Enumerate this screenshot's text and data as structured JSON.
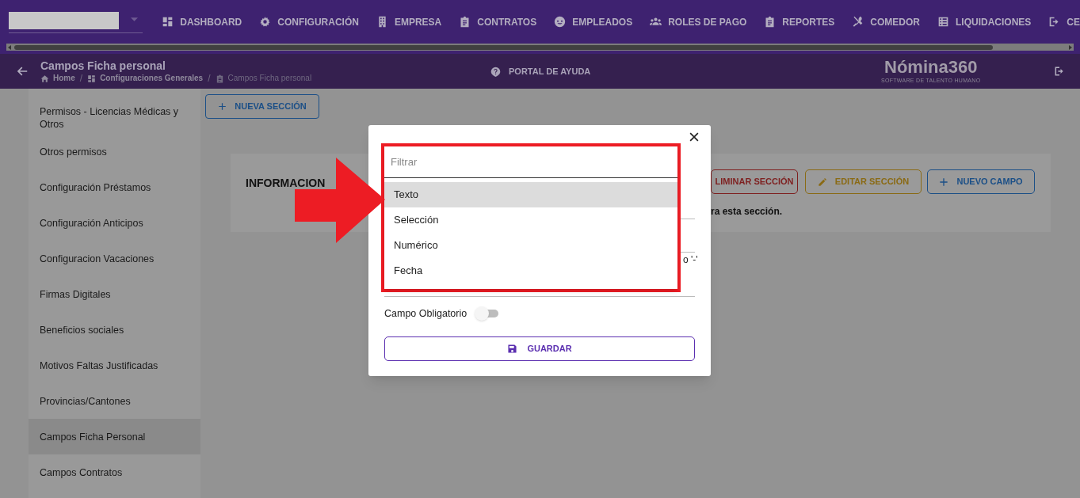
{
  "nav": {
    "items": [
      {
        "label": "DASHBOARD"
      },
      {
        "label": "CONFIGURACIÓN"
      },
      {
        "label": "EMPRESA"
      },
      {
        "label": "CONTRATOS"
      },
      {
        "label": "EMPLEADOS"
      },
      {
        "label": "ROLES DE PAGO"
      },
      {
        "label": "REPORTES"
      },
      {
        "label": "COMEDOR"
      },
      {
        "label": "LIQUIDACIONES"
      },
      {
        "label": "CE"
      }
    ]
  },
  "header": {
    "title": "Campos Ficha personal",
    "breadcrumb": [
      {
        "kind": "link",
        "label": "Home"
      },
      {
        "kind": "separator",
        "label": "/"
      },
      {
        "kind": "link",
        "label": "Configuraciones Generales"
      },
      {
        "kind": "separator",
        "label": "/"
      },
      {
        "kind": "current",
        "label": "Campos Ficha personal"
      }
    ],
    "help": "PORTAL DE AYUDA",
    "logo": "Nómina360",
    "logo_tagline": "SOFTWARE DE TALENTO HUMANO"
  },
  "sidebar": {
    "items": [
      {
        "label": "Permisos - Licencias Médicas y Otros",
        "selected": false
      },
      {
        "label": "Otros permisos",
        "selected": false
      },
      {
        "label": "Configuración Préstamos",
        "selected": false
      },
      {
        "label": "Configuración Anticipos",
        "selected": false
      },
      {
        "label": "Configuracion Vacaciones",
        "selected": false
      },
      {
        "label": "Firmas Digitales",
        "selected": false
      },
      {
        "label": "Beneficios sociales",
        "selected": false
      },
      {
        "label": "Motivos Faltas Justificadas",
        "selected": false
      },
      {
        "label": "Provincias/Cantones",
        "selected": false
      },
      {
        "label": "Campos Ficha Personal",
        "selected": true
      },
      {
        "label": "Campos Contratos",
        "selected": false
      }
    ]
  },
  "new_section_button": "NUEVA SECCIÓN",
  "section_card": {
    "title": "INFORMACION",
    "buttons": [
      {
        "label": "LIMINAR SECCIÓN",
        "kind": "delete"
      },
      {
        "label": "EDITAR SECCIÓN",
        "kind": "edit"
      },
      {
        "label": "NUEVO CAMPO",
        "kind": "add"
      }
    ],
    "message": "ra esta sección."
  },
  "dialog": {
    "behind_text": "o '-'",
    "filter_placeholder": "Filtrar",
    "options": [
      {
        "label": "Texto",
        "selected": true
      },
      {
        "label": "Selección",
        "selected": false
      },
      {
        "label": "Numérico",
        "selected": false
      },
      {
        "label": "Fecha",
        "selected": false
      }
    ],
    "required_label": "Campo Obligatorio",
    "required_on": false,
    "save_button": "GUARDAR"
  }
}
